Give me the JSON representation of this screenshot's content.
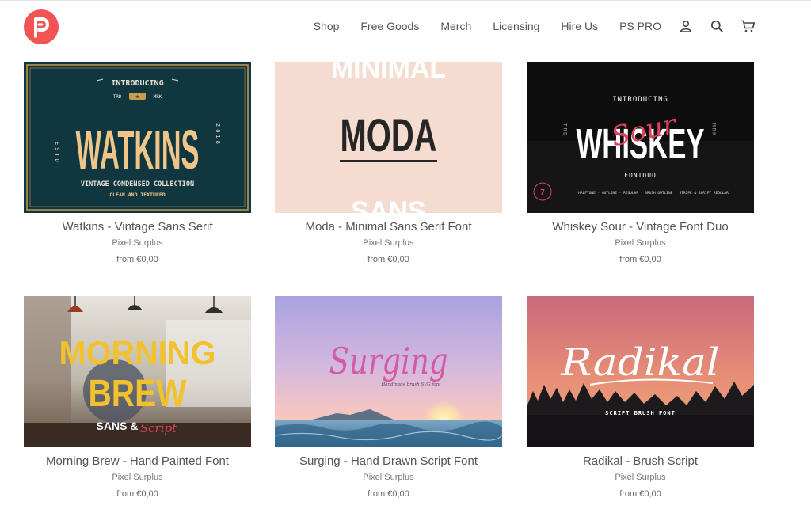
{
  "brand": {
    "accent": "#f25454"
  },
  "nav": {
    "items": [
      "Shop",
      "Free Goods",
      "Merch",
      "Licensing",
      "Hire Us",
      "PS PRO"
    ],
    "icons": [
      "account-icon",
      "search-icon",
      "cart-icon"
    ]
  },
  "products": [
    {
      "title": "Watkins - Vintage Sans Serif",
      "vendor": "Pixel Surplus",
      "price": "from €0,00",
      "art": {
        "intro": "INTRODUCING",
        "left": "TRD",
        "mid": "★",
        "right": "MRK",
        "main": "WATKINS",
        "side_left": "ESTD",
        "side_right": "2018",
        "sub": "VINTAGE CONDENSED COLLECTION",
        "sub2": "CLEAN AND TEXTURED"
      }
    },
    {
      "title": "Moda - Minimal Sans Serif Font",
      "vendor": "Pixel Surplus",
      "price": "from €0,00",
      "art": {
        "top": "MINIMAL",
        "main": "MODA",
        "bottom": "SANS"
      }
    },
    {
      "title": "Whiskey Sour - Vintage Font Duo",
      "vendor": "Pixel Surplus",
      "price": "from €0,00",
      "art": {
        "intro": "INTRODUCING",
        "main": "WHISKEY",
        "script": "Sour",
        "sub": "FONTDUO",
        "side_left": "TRD",
        "side_right": "MRK",
        "features": "HALFTONE · OUTLINE · REGULAR · BRUSH OUTLINE · STRIPE & SCRIPT REGULAR"
      }
    },
    {
      "title": "Morning Brew - Hand Painted Font",
      "vendor": "Pixel Surplus",
      "price": "from €0,00",
      "art": {
        "line1": "MORNING",
        "line2": "BREW",
        "line3": "SANS &",
        "script": "Script"
      }
    },
    {
      "title": "Surging - Hand Drawn Script Font",
      "vendor": "Pixel Surplus",
      "price": "from €0,00",
      "art": {
        "main": "Surging",
        "sub": "Handmade brush SVG font"
      }
    },
    {
      "title": "Radikal - Brush Script",
      "vendor": "Pixel Surplus",
      "price": "from €0,00",
      "art": {
        "main": "Radikal",
        "sub": "SCRIPT BRUSH FONT"
      }
    }
  ]
}
